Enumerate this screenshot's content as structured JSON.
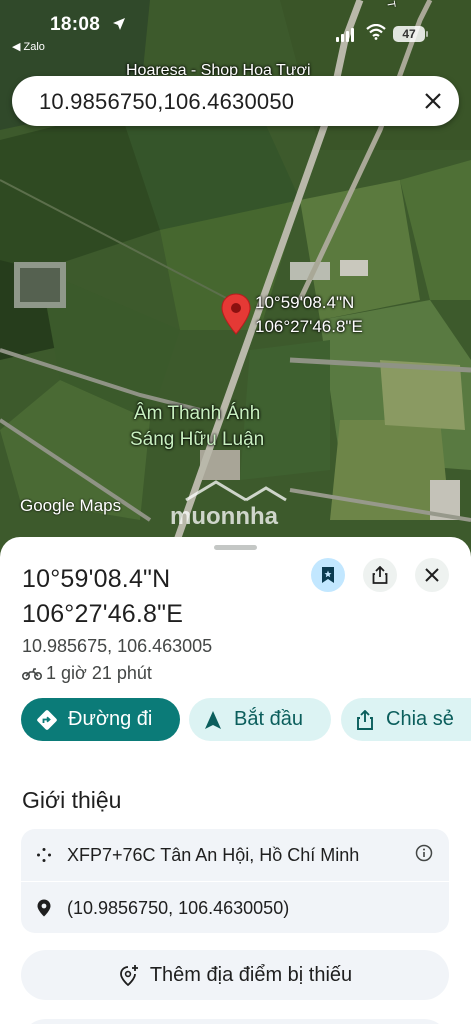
{
  "status_bar": {
    "time": "18:08",
    "back_app": "◀ Zalo",
    "battery": "47"
  },
  "map": {
    "shop_label": "Hoaresa - Shop Hoa Tươi",
    "road_label": "T",
    "coordinate_overlay": {
      "lat": "10°59'08.4\"N",
      "lng": "106°27'46.8\"E"
    },
    "poi_label": {
      "line1": "Âm Thanh Ánh",
      "line2": "Sáng Hữu Luận"
    },
    "google_logo": "Google Maps",
    "watermark": "muonnha"
  },
  "search": {
    "value": "10.9856750,106.4630050"
  },
  "place": {
    "title_line1": "10°59'08.4\"N",
    "title_line2": "106°27'46.8\"E",
    "decimal_coords": "10.985675, 106.463005",
    "travel_time": "1 giờ 21 phút"
  },
  "actions": {
    "directions": "Đường đi",
    "start": "Bắt đầu",
    "share": "Chia sẻ"
  },
  "about": {
    "section_title": "Giới thiệu",
    "plus_code": "XFP7+76C Tân An Hội, Hồ Chí Minh",
    "coords": "(10.9856750, 106.4630050)"
  },
  "add_missing": "Thêm địa điểm bị thiếu",
  "colors": {
    "primary": "#0b7b78",
    "tonal": "#dcf3f3",
    "pin": "#e53935",
    "save_bg": "#c2e7ff"
  }
}
